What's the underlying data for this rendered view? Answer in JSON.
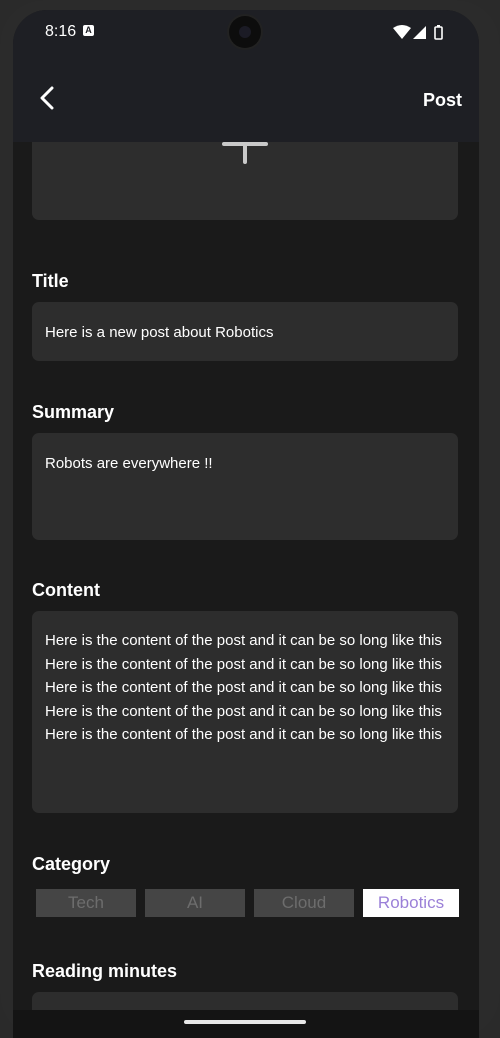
{
  "status_bar": {
    "time": "8:16",
    "notification_icon": "a-icon",
    "icons": [
      "wifi-icon",
      "signal-icon",
      "battery-icon"
    ]
  },
  "app_bar": {
    "back_icon": "chevron-left-icon",
    "action_label": "Post"
  },
  "form": {
    "title": {
      "label": "Title",
      "value": "Here is a new post about Robotics"
    },
    "summary": {
      "label": "Summary",
      "value": "Robots are everywhere !!"
    },
    "content": {
      "label": "Content",
      "value": "Here is the content of the post and it can be so long like this Here is the content of the post and it can be so long like this Here is the content of the post and it can be so long like this Here is the content of the post and it can be so long like this Here is the content of the post and it can be so long like this"
    },
    "category": {
      "label": "Category",
      "options": [
        "Tech",
        "AI",
        "Cloud",
        "Robotics"
      ],
      "selected": "Robotics"
    },
    "reading_minutes": {
      "label": "Reading minutes"
    }
  },
  "colors": {
    "background": "#1a1a1a",
    "field": "#2d2d2d",
    "appbar": "#1e1f24",
    "accent": "#9b80d8"
  }
}
